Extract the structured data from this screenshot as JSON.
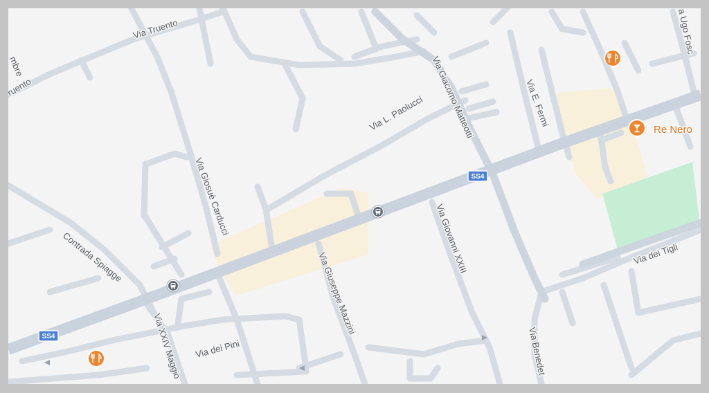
{
  "map": {
    "colors": {
      "background": "#f4f4f5",
      "frame": "#c4c4c4",
      "road": "#d4dbe3",
      "highway": "#c9d2dd",
      "commercial_area": "#f9f0dc",
      "park": "#c6eed5",
      "poi_orange": "#f0842c",
      "shield_blue": "#4a7fd4"
    },
    "streets": {
      "via_truento": "Via Truento",
      "truento_left": "ruento",
      "mbre": "mbre",
      "via_ugo_foscolo": "a Ugo Fosc",
      "via_l_paolucci": "Via L. Paolucci",
      "via_giacomo_matteotti": "Via Giacomo Matteotti",
      "via_e_fermi": "Via E. Fermi",
      "via_giosue_carducci": "Via Giosuè Carducci",
      "contrada_spiagge": "Contrada Spiagge",
      "via_giovanni_xxiii": "Via Giovanni XXIII",
      "via_giuseppe_mazzini": "Via Giuseppe Mazzini",
      "via_dei_tigli": "Via dei Tigli",
      "via_xxiv_maggio": "Via XXIV Maggio",
      "via_dei_pini": "Via dei Pini",
      "via_benedetto": "Via Benedet"
    },
    "shields": {
      "ss4_east": "SS4",
      "ss4_west": "SS4"
    },
    "pois": [
      {
        "name": "",
        "icon": "restaurant-icon"
      },
      {
        "name": "Re Nero",
        "icon": "cocktail-bar-icon"
      },
      {
        "name": "",
        "icon": "restaurant-icon"
      }
    ],
    "transit": [
      {
        "icon": "bus-stop-icon"
      },
      {
        "icon": "bus-stop-icon"
      }
    ]
  }
}
